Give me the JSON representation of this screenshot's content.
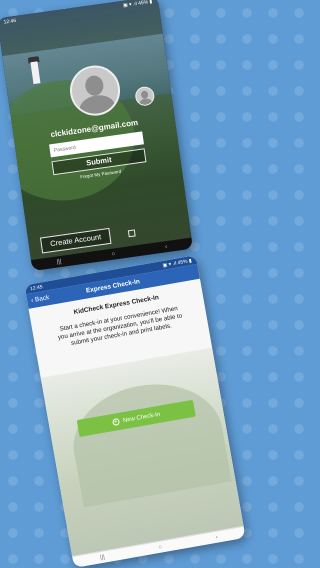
{
  "login_screen": {
    "status": {
      "time": "12:46",
      "right": "▣ ▾ .ıl 45% ▮"
    },
    "email": "clckidzone@gmail.com",
    "password_placeholder": "Password",
    "submit_label": "Submit",
    "forgot_label": "Forgot My Password",
    "create_account_label": "Create Account",
    "nav": {
      "left": "|||",
      "home": "○",
      "back": "‹"
    }
  },
  "checkin_screen": {
    "status": {
      "time": "12:45",
      "right": "▣ ▾ .ıl 45% ▮"
    },
    "back_label": "‹ Back",
    "header_title": "Express Check-In",
    "content_title": "KidCheck Express Check-In",
    "description": "Start a check-in at your convenience! When you arrive at the organization, you'll be able to submit your check-in and print labels.",
    "new_checkin_label": "New Check-In",
    "nav": {
      "left": "|||",
      "home": "○",
      "back": "‹"
    }
  },
  "colors": {
    "background": "#5f9cd6",
    "header_blue": "#2c65b8",
    "button_green": "#7bc143"
  }
}
